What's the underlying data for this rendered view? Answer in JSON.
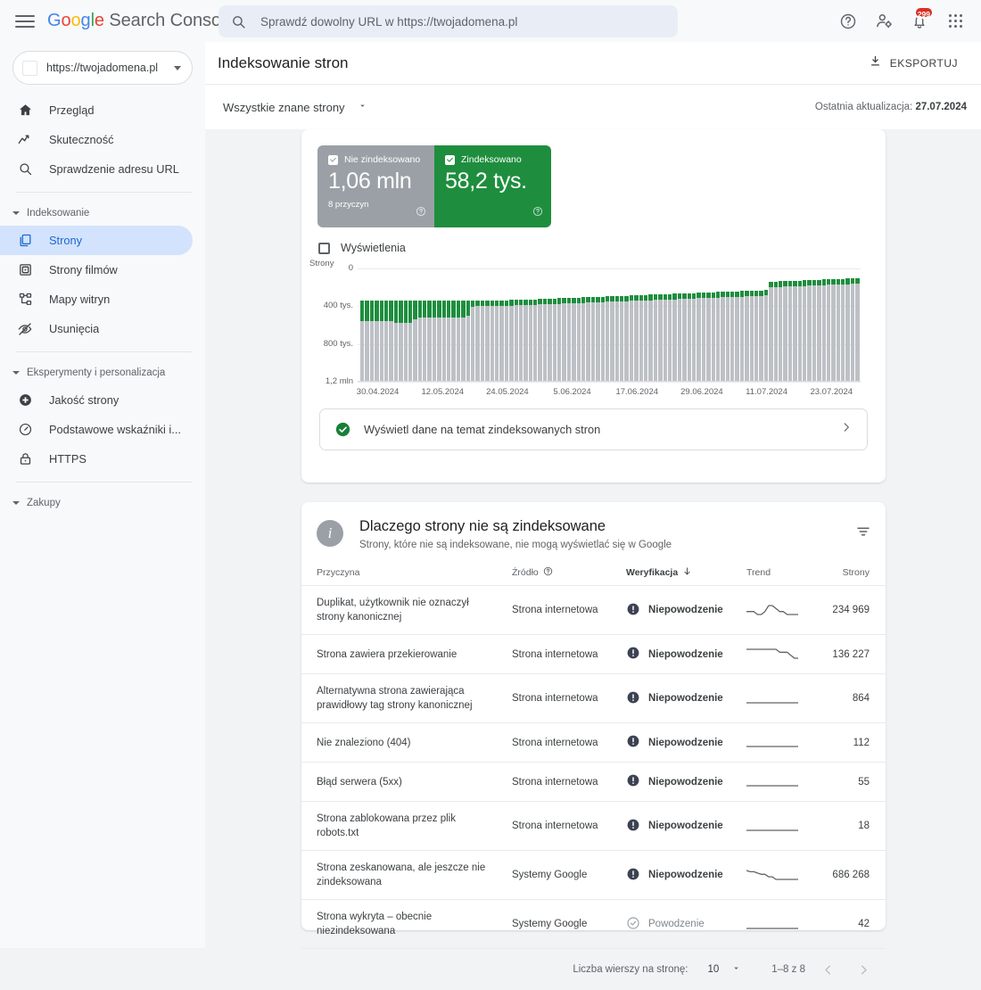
{
  "topbar": {
    "menu_icon": "hamburger-menu-icon",
    "brand": {
      "google": "Google",
      "product": "Search Console"
    },
    "search": {
      "icon": "search-icon",
      "placeholder": "Sprawdź dowolny URL w https://twojadomena.pl",
      "value": ""
    },
    "icons": {
      "help": "help-circle-icon",
      "accounts": "user-settings-icon",
      "notifications": "bell-icon",
      "apps": "apps-grid-icon"
    },
    "notification_badge": "299"
  },
  "sidebar": {
    "property": {
      "url": "https://twojadomena.pl",
      "favicon": "site-favicon",
      "caret": "chevron-down-icon"
    },
    "items": [
      {
        "label": "Przegląd",
        "icon": "home-icon",
        "active": false
      },
      {
        "label": "Skuteczność",
        "icon": "trending-up-icon",
        "active": false
      },
      {
        "label": "Sprawdzenie adresu URL",
        "icon": "search-icon",
        "active": false
      }
    ],
    "group_indexing": {
      "label": "Indeksowanie",
      "expanded": true
    },
    "indexing_items": [
      {
        "label": "Strony",
        "icon": "pages-icon",
        "active": true
      },
      {
        "label": "Strony filmów",
        "icon": "video-page-icon",
        "active": false
      },
      {
        "label": "Mapy witryn",
        "icon": "sitemap-icon",
        "active": false
      },
      {
        "label": "Usunięcia",
        "icon": "eye-off-icon",
        "active": false
      }
    ],
    "group_experiments": {
      "label": "Eksperymenty i personalizacja",
      "expanded": true
    },
    "experiment_items": [
      {
        "label": "Jakość strony",
        "icon": "page-experience-icon",
        "active": false
      },
      {
        "label": "Podstawowe wskaźniki i...",
        "icon": "speedometer-icon",
        "active": false
      },
      {
        "label": "HTTPS",
        "icon": "lock-icon",
        "active": false
      }
    ],
    "group_shopping": {
      "label": "Zakupy",
      "expanded": true
    }
  },
  "page": {
    "title": "Indeksowanie stron",
    "export": {
      "label": "EKSPORTUJ",
      "icon": "download-icon"
    },
    "filter": {
      "label": "Wszystkie znane strony",
      "icon": "chevron-down-icon"
    },
    "last_update_prefix": "Ostatnia aktualizacja:",
    "last_update_value": "27.07.2024"
  },
  "metrics": [
    {
      "label": "Nie zindeksowano",
      "value": "1,06 mln",
      "sub": "8 przyczyn",
      "checked": true,
      "color": "#9AA0A6",
      "help_icon": "help-circle-icon"
    },
    {
      "label": "Zindeksowano",
      "value": "58,2 tys.",
      "sub": "",
      "checked": true,
      "color": "#1E8E3E",
      "help_icon": "help-circle-icon"
    }
  ],
  "views_toggle": {
    "label": "Wyświetlenia",
    "checked": false
  },
  "chart_data": {
    "type": "bar",
    "stacked": true,
    "title": "",
    "ylabel": "Strony",
    "xlabel": "",
    "ylim": [
      0,
      1200000
    ],
    "yticks": [
      0,
      400000,
      800000,
      1200000
    ],
    "ytick_labels": [
      "0",
      "400 tys.",
      "800 tys.",
      "1,2 mln"
    ],
    "grid": true,
    "legend_position": "top",
    "series": [
      {
        "name": "Nie zindeksowano",
        "color": "#BDC1C6",
        "values": [
          640000,
          640000,
          640000,
          640000,
          640000,
          640000,
          640000,
          622000,
          622000,
          622000,
          622000,
          662000,
          680000,
          680000,
          680000,
          680000,
          680000,
          680000,
          680000,
          680000,
          680000,
          682000,
          700000,
          798000,
          800000,
          800000,
          802000,
          802000,
          804000,
          804000,
          806000,
          808000,
          810000,
          812000,
          812000,
          814000,
          816000,
          818000,
          820000,
          822000,
          824000,
          826000,
          828000,
          830000,
          832000,
          834000,
          836000,
          838000,
          840000,
          842000,
          844000,
          846000,
          848000,
          850000,
          852000,
          854000,
          856000,
          858000,
          860000,
          862000,
          864000,
          866000,
          868000,
          870000,
          872000,
          874000,
          876000,
          878000,
          880000,
          882000,
          884000,
          886000,
          888000,
          890000,
          892000,
          894000,
          896000,
          898000,
          900000,
          902000,
          904000,
          906000,
          908000,
          910000,
          912000,
          1002000,
          1004000,
          1006000,
          1008000,
          1010000,
          1012000,
          1014000,
          1016000,
          1018000,
          1020000,
          1022000,
          1024000,
          1026000,
          1028000,
          1030000,
          1032000,
          1034000,
          1036000,
          1038000
        ]
      },
      {
        "name": "Zindeksowano",
        "color": "#1E8E3E",
        "values": [
          222000,
          222000,
          222000,
          222000,
          222000,
          222000,
          222000,
          240000,
          240000,
          240000,
          240000,
          200000,
          182000,
          182000,
          182000,
          182000,
          182000,
          182000,
          182000,
          182000,
          182000,
          180000,
          160000,
          62000,
          60000,
          60000,
          58000,
          58000,
          58000,
          58000,
          58000,
          58000,
          58000,
          58000,
          58000,
          58000,
          58000,
          58000,
          58000,
          58000,
          58000,
          58000,
          58000,
          58000,
          58000,
          58000,
          58000,
          58000,
          58000,
          58000,
          58000,
          58000,
          58000,
          58000,
          58000,
          58000,
          58000,
          58000,
          58000,
          58000,
          58000,
          58000,
          58000,
          58000,
          58000,
          58000,
          58000,
          58000,
          58000,
          58000,
          58000,
          58000,
          58000,
          58000,
          58000,
          58000,
          58000,
          58000,
          58000,
          58000,
          58000,
          58000,
          58000,
          58000,
          58000,
          58200,
          58200,
          58200,
          58200,
          58200,
          58200,
          58200,
          58200,
          58200,
          58200,
          58200,
          58200,
          58200,
          58200,
          58200,
          58200,
          58200,
          58200,
          58200
        ]
      }
    ],
    "xtick_labels": [
      "30.04.2024",
      "12.05.2024",
      "24.05.2024",
      "5.06.2024",
      "17.06.2024",
      "29.06.2024",
      "11.07.2024",
      "23.07.2024"
    ],
    "xtick_positions": [
      0.035,
      0.165,
      0.295,
      0.425,
      0.555,
      0.685,
      0.815,
      0.945
    ]
  },
  "banner": {
    "icon": "check-circle-filled-icon",
    "text": "Wyświetl dane na temat zindeksowanych stron",
    "chevron": "chevron-right-icon"
  },
  "reasons_card": {
    "icon": "info-circle-icon",
    "title": "Dlaczego strony nie są zindeksowane",
    "subtitle": "Strony, które nie są indeksowane, nie mogą wyświetlać się w Google",
    "filter_icon": "filter-list-icon",
    "columns": [
      {
        "key": "reason",
        "label": "Przyczyna"
      },
      {
        "key": "source",
        "label": "Źródło",
        "help_icon": "help-circle-icon"
      },
      {
        "key": "verification",
        "label": "Weryfikacja",
        "sort_icon": "arrow-down-icon",
        "sorted": true
      },
      {
        "key": "trend",
        "label": "Trend"
      },
      {
        "key": "pages",
        "label": "Strony"
      }
    ],
    "rows": [
      {
        "reason": "Duplikat, użytkownik nie oznaczył strony kanonicznej",
        "source": "Strona internetowa",
        "verification": "Niepowodzenie",
        "status": "fail",
        "trend": [
          12,
          12,
          12,
          11,
          11,
          12,
          14,
          14,
          13,
          12,
          12,
          11,
          11,
          11,
          11
        ],
        "pages": "234 969"
      },
      {
        "reason": "Strona zawiera przekierowanie",
        "source": "Strona internetowa",
        "verification": "Niepowodzenie",
        "status": "fail",
        "trend": [
          13,
          13,
          13,
          13,
          13,
          13,
          13,
          13,
          13,
          12,
          12,
          12,
          11,
          10,
          10
        ],
        "pages": "136 227"
      },
      {
        "reason": "Alternatywna strona zawierająca prawidłowy tag strony kanonicznej",
        "source": "Strona internetowa",
        "verification": "Niepowodzenie",
        "status": "fail",
        "trend": [
          12,
          12,
          12,
          12,
          12,
          12,
          12,
          12,
          12,
          12,
          12,
          12,
          12,
          12,
          12
        ],
        "pages": "864"
      },
      {
        "reason": "Nie znaleziono (404)",
        "source": "Strona internetowa",
        "verification": "Niepowodzenie",
        "status": "fail",
        "trend": [
          12,
          12,
          12,
          12,
          12,
          12,
          12,
          12,
          12,
          12,
          12,
          12,
          12,
          12,
          12
        ],
        "pages": "112"
      },
      {
        "reason": "Błąd serwera (5xx)",
        "source": "Strona internetowa",
        "verification": "Niepowodzenie",
        "status": "fail",
        "trend": [
          12,
          12,
          12,
          12,
          12,
          12,
          12,
          12,
          12,
          12,
          12,
          12,
          12,
          12,
          12
        ],
        "pages": "55"
      },
      {
        "reason": "Strona zablokowana przez plik robots.txt",
        "source": "Strona internetowa",
        "verification": "Niepowodzenie",
        "status": "fail",
        "trend": [
          12,
          12,
          12,
          12,
          12,
          12,
          12,
          12,
          12,
          12,
          12,
          12,
          12,
          12,
          12
        ],
        "pages": "18"
      },
      {
        "reason": "Strona zeskanowana, ale jeszcze nie zindeksowana",
        "source": "Systemy Google",
        "verification": "Niepowodzenie",
        "status": "fail",
        "trend": [
          16,
          15,
          15,
          14,
          13,
          13,
          11,
          11,
          9,
          9,
          9,
          9,
          9,
          9,
          9
        ],
        "pages": "686 268"
      },
      {
        "reason": "Strona wykryta – obecnie niezindeksowana",
        "source": "Systemy Google",
        "verification": "Powodzenie",
        "status": "ok",
        "trend": [
          12,
          12,
          12,
          12,
          12,
          12,
          12,
          12,
          12,
          12,
          12,
          12,
          12,
          12,
          12
        ],
        "pages": "42"
      }
    ],
    "footer": {
      "rows_label": "Liczba wierszy na stronę:",
      "rows_value": "10",
      "rows_caret": "chevron-down-icon",
      "range": "1–8 z 8",
      "prev_icon": "chevron-left-icon",
      "next_icon": "chevron-right-icon",
      "prev_disabled": true,
      "next_disabled": true
    }
  },
  "colors": {
    "green": "#1E8E3E",
    "grey": "#9AA0A6",
    "accent_blue": "#1967D2",
    "active_nav_bg": "#D3E3FD",
    "red_badge": "#D93025",
    "fail_icon": "#3C4251"
  }
}
